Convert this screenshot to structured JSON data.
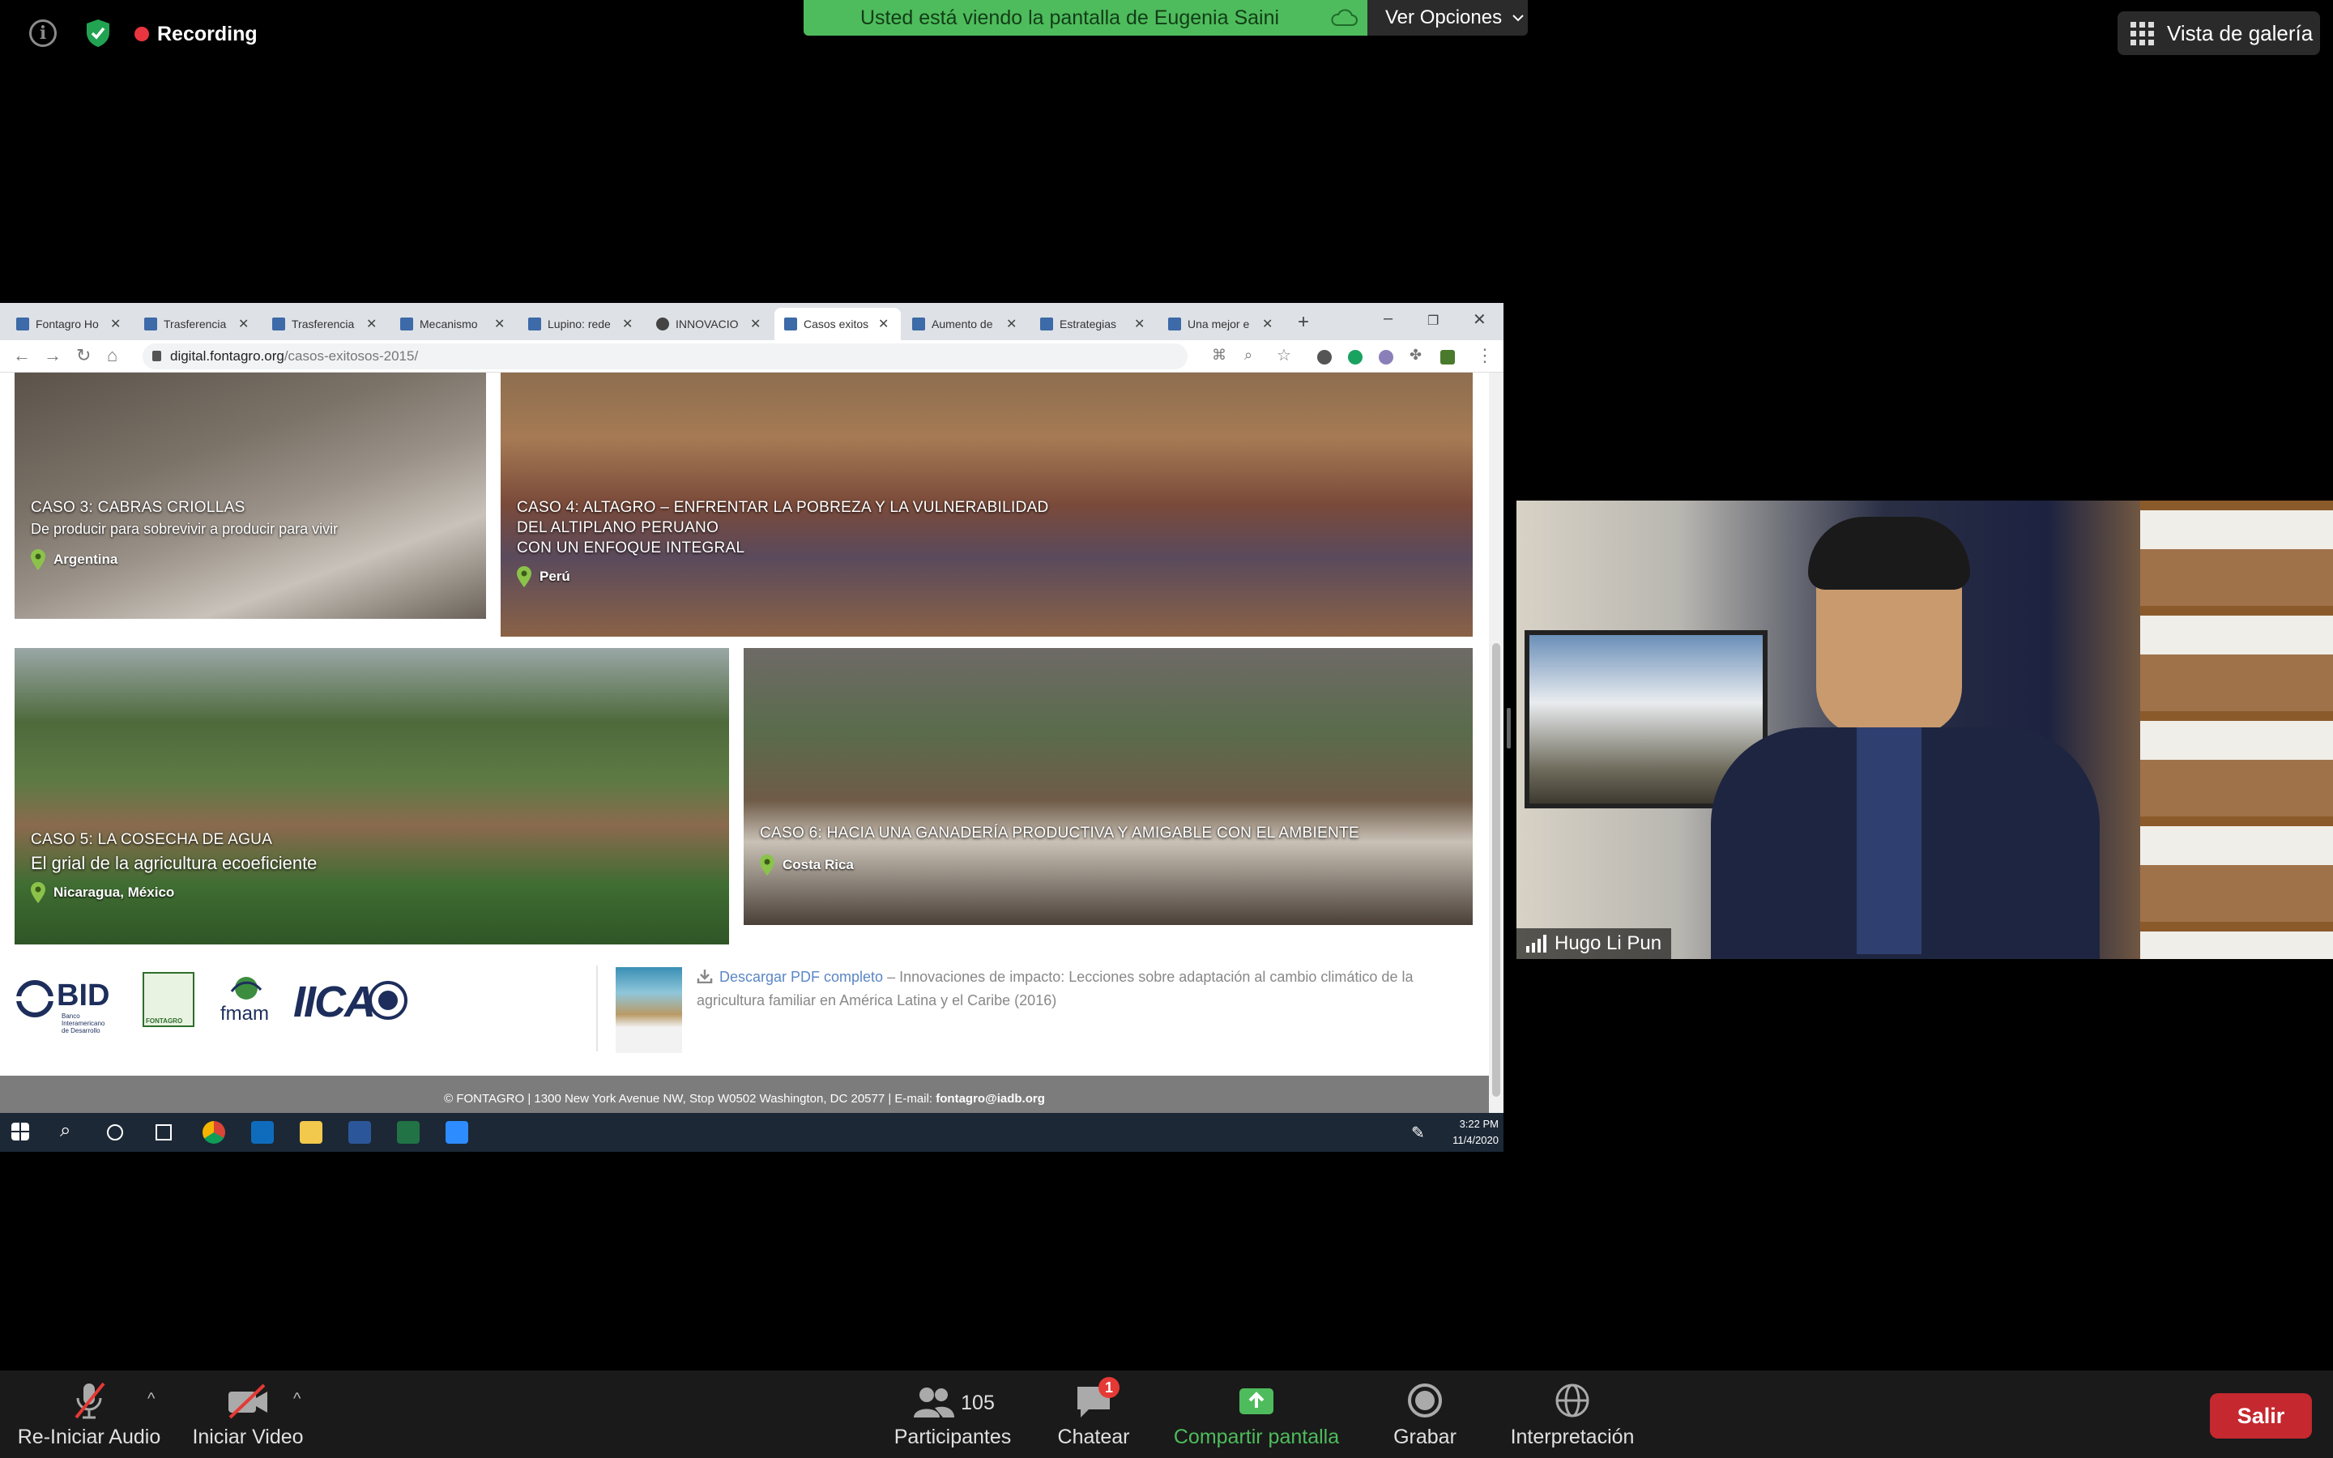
{
  "zoom": {
    "recording_label": "Recording",
    "share_banner": "Usted está viendo la pantalla de Eugenia Saini",
    "view_options": "Ver Opciones",
    "gallery_view": "Vista de galería",
    "participant_name": "Hugo Li Pun",
    "toolbar": {
      "audio": "Re-Iniciar Audio",
      "video": "Iniciar Video",
      "participants": "Participantes",
      "participants_count": "105",
      "chat": "Chatear",
      "chat_badge": "1",
      "share": "Compartir pantalla",
      "record": "Grabar",
      "interpretation": "Interpretación",
      "leave": "Salir"
    },
    "colors": {
      "share_green": "#4ebc5c",
      "leave_red": "#c5282f",
      "record_red": "#e8353f"
    }
  },
  "browser": {
    "tabs": [
      {
        "title": "Fontagro Ho"
      },
      {
        "title": "Trasferencia"
      },
      {
        "title": "Trasferencia"
      },
      {
        "title": "Mecanismo"
      },
      {
        "title": "Lupino: rede"
      },
      {
        "title": "INNOVACIO"
      },
      {
        "title": "Casos exitos"
      },
      {
        "title": "Aumento de"
      },
      {
        "title": "Estrategias"
      },
      {
        "title": "Una mejor e"
      }
    ],
    "active_tab": 6,
    "url_host": "digital.fontagro.org",
    "url_path": "/casos-exitosos-2015/"
  },
  "page": {
    "cards": [
      {
        "title": "CASO 3: CABRAS CRIOLLAS",
        "subtitle": "De producir para sobrevivir a producir para vivir",
        "location": "Argentina"
      },
      {
        "title_lines": [
          "CASO 4: ALTAGRO – ENFRENTAR LA POBREZA Y LA VULNERABILIDAD",
          "DEL ALTIPLANO PERUANO",
          "CON UN ENFOQUE INTEGRAL"
        ],
        "location": "Perú"
      },
      {
        "title": "CASO 5: LA COSECHA DE AGUA",
        "subtitle": "El grial de la agricultura ecoeficiente",
        "location": "Nicaragua, México"
      },
      {
        "title": "CASO 6: HACIA UNA GANADERÍA PRODUCTIVA Y AMIGABLE CON EL AMBIENTE",
        "location": "Costa Rica"
      }
    ],
    "logos": {
      "bid": "BID",
      "bid_sub": "Banco Interamericano de Desarrollo",
      "fontagro": "FONTAGRO",
      "fmam": "fmam",
      "iica": "IICA"
    },
    "download_link": "Descargar PDF completo",
    "download_text": " – Innovaciones de impacto: Lecciones sobre adaptación al cambio climático de la agricultura familiar en América Latina y el Caribe (2016)",
    "footer": "© FONTAGRO | 1300 New York Avenue NW, Stop W0502 Washington, DC 20577 | E-mail: ",
    "footer_email": "fontagro@iadb.org"
  },
  "taskbar": {
    "time": "3:22 PM",
    "date": "11/4/2020"
  }
}
